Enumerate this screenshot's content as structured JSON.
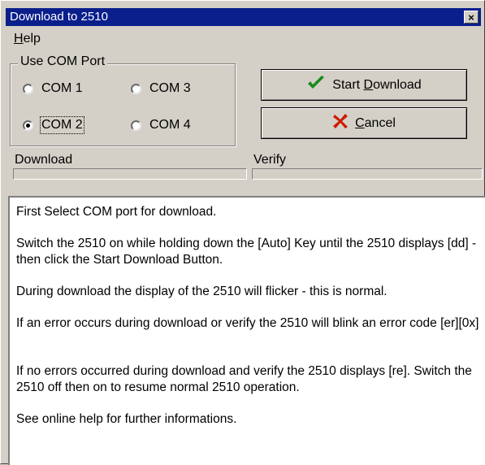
{
  "window": {
    "title": "Download to 2510",
    "close_label": "×"
  },
  "menu": {
    "help_first": "H",
    "help_rest": "elp"
  },
  "com_group": {
    "label": "Use COM Port",
    "options": [
      {
        "label": "COM 1",
        "checked": false
      },
      {
        "label": "COM 3",
        "checked": false
      },
      {
        "label": "COM 2",
        "checked": true
      },
      {
        "label": "COM 4",
        "checked": false
      }
    ]
  },
  "buttons": {
    "start": {
      "pre": "Start ",
      "mnemonic": "D",
      "post": "ownload",
      "icon": "checkmark-icon",
      "icon_color": "#1a8a1a"
    },
    "cancel": {
      "pre": "",
      "mnemonic": "C",
      "post": "ancel",
      "icon": "x-icon",
      "icon_color": "#cc1a00"
    }
  },
  "progress": {
    "download": {
      "label": "Download",
      "value": 0
    },
    "verify": {
      "label": "Verify",
      "value": 0
    }
  },
  "instructions": [
    "First Select COM port for download.",
    "Switch the 2510 on while holding down the [Auto] Key until the 2510 displays [dd] - then click the Start Download Button.",
    "During download the display of the 2510 will flicker - this is normal.",
    "If an error occurs during download or verify the 2510 will blink an error code [er][0x]",
    "If no errors occurred during download and verify the 2510 displays [re]. Switch the 2510 off then on to resume normal 2510 operation.",
    "See online help for further informations."
  ]
}
